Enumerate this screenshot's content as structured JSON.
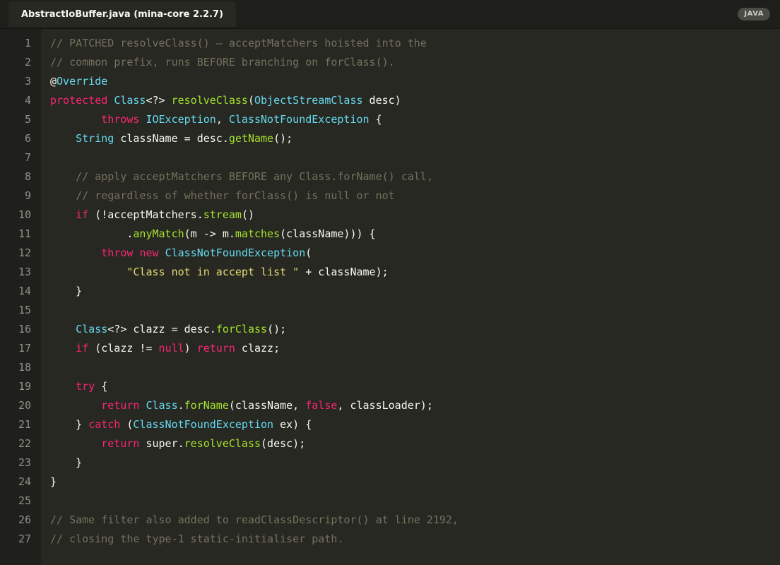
{
  "colors": {
    "background": "#272822",
    "gutter": "#1f201b",
    "tabbar": "#1e1f1a",
    "comment": "#75715e",
    "keyword": "#f92672",
    "type": "#66d9ef",
    "function": "#a6e22e",
    "string": "#e6db74",
    "plain": "#f8f8f2",
    "line_number": "#90908a"
  },
  "tab": {
    "title": "AbstractIoBuffer.java (mina-core 2.2.7)"
  },
  "language_badge": "JAVA",
  "lines": [
    {
      "n": "1",
      "tokens": [
        [
          "comment",
          "// PATCHED resolveClass() — acceptMatchers hoisted into the"
        ]
      ]
    },
    {
      "n": "2",
      "tokens": [
        [
          "comment",
          "// common prefix, runs BEFORE branching on forClass()."
        ]
      ]
    },
    {
      "n": "3",
      "tokens": [
        [
          "plain",
          "@"
        ],
        [
          "annotation",
          "Override"
        ]
      ]
    },
    {
      "n": "4",
      "tokens": [
        [
          "keyword",
          "protected"
        ],
        [
          "plain",
          " "
        ],
        [
          "type",
          "Class"
        ],
        [
          "plain",
          "<?> "
        ],
        [
          "func",
          "resolveClass"
        ],
        [
          "plain",
          "("
        ],
        [
          "type",
          "ObjectStreamClass"
        ],
        [
          "plain",
          " desc)"
        ]
      ]
    },
    {
      "n": "5",
      "tokens": [
        [
          "plain",
          "        "
        ],
        [
          "keyword",
          "throws"
        ],
        [
          "plain",
          " "
        ],
        [
          "type",
          "IOException"
        ],
        [
          "plain",
          ", "
        ],
        [
          "type",
          "ClassNotFoundException"
        ],
        [
          "plain",
          " {"
        ]
      ]
    },
    {
      "n": "6",
      "tokens": [
        [
          "plain",
          "    "
        ],
        [
          "type",
          "String"
        ],
        [
          "plain",
          " className = desc."
        ],
        [
          "func",
          "getName"
        ],
        [
          "plain",
          "();"
        ]
      ]
    },
    {
      "n": "7",
      "tokens": []
    },
    {
      "n": "8",
      "tokens": [
        [
          "plain",
          "    "
        ],
        [
          "comment",
          "// apply acceptMatchers BEFORE any Class.forName() call,"
        ]
      ]
    },
    {
      "n": "9",
      "tokens": [
        [
          "plain",
          "    "
        ],
        [
          "comment",
          "// regardless of whether forClass() is null or not"
        ]
      ]
    },
    {
      "n": "10",
      "tokens": [
        [
          "plain",
          "    "
        ],
        [
          "keyword",
          "if"
        ],
        [
          "plain",
          " (!acceptMatchers."
        ],
        [
          "func",
          "stream"
        ],
        [
          "plain",
          "()"
        ]
      ]
    },
    {
      "n": "11",
      "tokens": [
        [
          "plain",
          "            ."
        ],
        [
          "func",
          "anyMatch"
        ],
        [
          "plain",
          "(m -> m."
        ],
        [
          "func",
          "matches"
        ],
        [
          "plain",
          "(className))) {"
        ]
      ]
    },
    {
      "n": "12",
      "tokens": [
        [
          "plain",
          "        "
        ],
        [
          "keyword",
          "throw"
        ],
        [
          "plain",
          " "
        ],
        [
          "keyword",
          "new"
        ],
        [
          "plain",
          " "
        ],
        [
          "type",
          "ClassNotFoundException"
        ],
        [
          "plain",
          "("
        ]
      ]
    },
    {
      "n": "13",
      "tokens": [
        [
          "plain",
          "            "
        ],
        [
          "string",
          "\"Class not in accept list \""
        ],
        [
          "plain",
          " + className);"
        ]
      ]
    },
    {
      "n": "14",
      "tokens": [
        [
          "plain",
          "    }"
        ]
      ]
    },
    {
      "n": "15",
      "tokens": []
    },
    {
      "n": "16",
      "tokens": [
        [
          "plain",
          "    "
        ],
        [
          "type",
          "Class"
        ],
        [
          "plain",
          "<?> clazz = desc."
        ],
        [
          "func",
          "forClass"
        ],
        [
          "plain",
          "();"
        ]
      ]
    },
    {
      "n": "17",
      "tokens": [
        [
          "plain",
          "    "
        ],
        [
          "keyword",
          "if"
        ],
        [
          "plain",
          " (clazz != "
        ],
        [
          "keyword",
          "null"
        ],
        [
          "plain",
          ") "
        ],
        [
          "keyword",
          "return"
        ],
        [
          "plain",
          " clazz;"
        ]
      ]
    },
    {
      "n": "18",
      "tokens": []
    },
    {
      "n": "19",
      "tokens": [
        [
          "plain",
          "    "
        ],
        [
          "keyword",
          "try"
        ],
        [
          "plain",
          " {"
        ]
      ]
    },
    {
      "n": "20",
      "tokens": [
        [
          "plain",
          "        "
        ],
        [
          "keyword",
          "return"
        ],
        [
          "plain",
          " "
        ],
        [
          "type",
          "Class"
        ],
        [
          "plain",
          "."
        ],
        [
          "func",
          "forName"
        ],
        [
          "plain",
          "(className, "
        ],
        [
          "keyword",
          "false"
        ],
        [
          "plain",
          ", classLoader);"
        ]
      ]
    },
    {
      "n": "21",
      "tokens": [
        [
          "plain",
          "    } "
        ],
        [
          "keyword",
          "catch"
        ],
        [
          "plain",
          " ("
        ],
        [
          "type",
          "ClassNotFoundException"
        ],
        [
          "plain",
          " ex) {"
        ]
      ]
    },
    {
      "n": "22",
      "tokens": [
        [
          "plain",
          "        "
        ],
        [
          "keyword",
          "return"
        ],
        [
          "plain",
          " super."
        ],
        [
          "func",
          "resolveClass"
        ],
        [
          "plain",
          "(desc);"
        ]
      ]
    },
    {
      "n": "23",
      "tokens": [
        [
          "plain",
          "    }"
        ]
      ]
    },
    {
      "n": "24",
      "tokens": [
        [
          "plain",
          "}"
        ]
      ]
    },
    {
      "n": "25",
      "tokens": []
    },
    {
      "n": "26",
      "tokens": [
        [
          "comment",
          "// Same filter also added to readClassDescriptor() at line 2192,"
        ]
      ]
    },
    {
      "n": "27",
      "tokens": [
        [
          "comment",
          "// closing the type-1 static-initialiser path."
        ]
      ]
    }
  ]
}
